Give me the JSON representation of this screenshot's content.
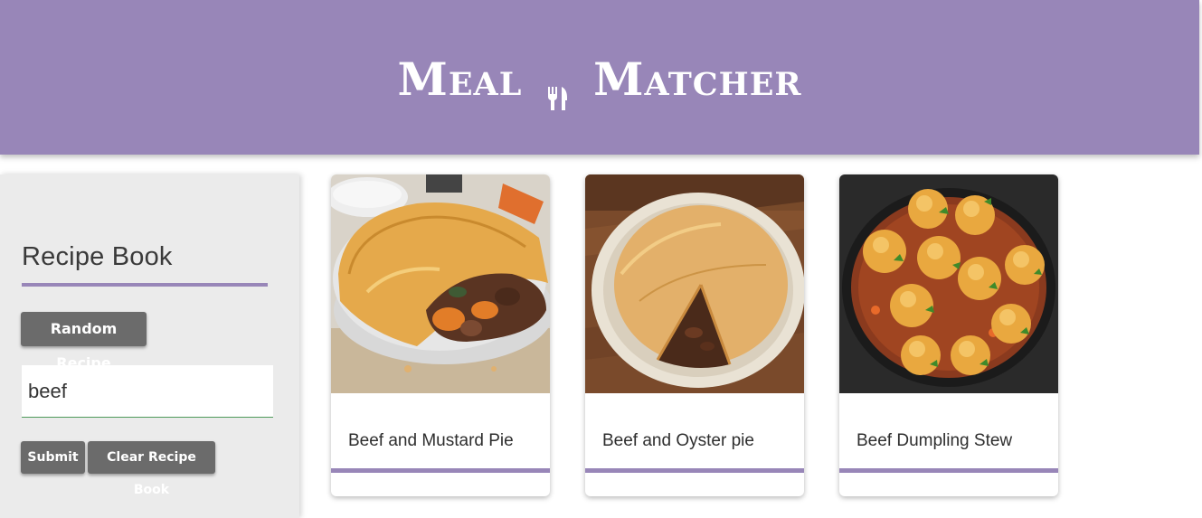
{
  "header": {
    "title_left": "Meal",
    "title_right": "Matcher",
    "icon": "fork-knife-icon",
    "background_color": "#9886b8"
  },
  "sidebar": {
    "title": "Recipe Book",
    "random_button_label": "Random Recipe",
    "search_value": "beef",
    "submit_label": "Submit",
    "clear_label": "Clear Recipe Book",
    "button_color": "#6b6b6b",
    "accent_color": "#9886b8"
  },
  "recipes": [
    {
      "title": "Beef and Mustard Pie",
      "image": "meat-pie-image"
    },
    {
      "title": "Beef and Oyster pie",
      "image": "sliced-pie-image"
    },
    {
      "title": "Beef Dumpling Stew",
      "image": "dumpling-stew-image"
    }
  ]
}
